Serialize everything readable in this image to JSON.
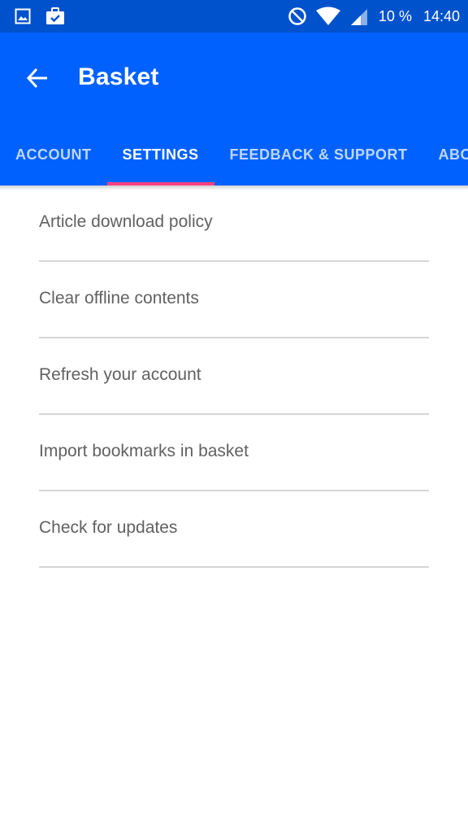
{
  "status_bar": {
    "icons_left": [
      "image-icon",
      "clipboard-check-icon"
    ],
    "icons_right": [
      "do-not-disturb-icon",
      "wifi-icon",
      "signal-icon"
    ],
    "battery": "10 %",
    "time": "14:40"
  },
  "app_bar": {
    "title": "Basket",
    "back_icon": "arrow-back-icon",
    "color": "#0061ff"
  },
  "tabs": [
    {
      "label": "ACCOUNT",
      "active": false
    },
    {
      "label": "SETTINGS",
      "active": true
    },
    {
      "label": "FEEDBACK & SUPPORT",
      "active": false
    },
    {
      "label": "ABOUT",
      "active": false
    }
  ],
  "accent_color": "#ff4081",
  "settings": {
    "items": [
      {
        "label": "Article download policy"
      },
      {
        "label": "Clear offline contents"
      },
      {
        "label": "Refresh your account"
      },
      {
        "label": "Import bookmarks in basket"
      },
      {
        "label": "Check for updates"
      }
    ]
  }
}
